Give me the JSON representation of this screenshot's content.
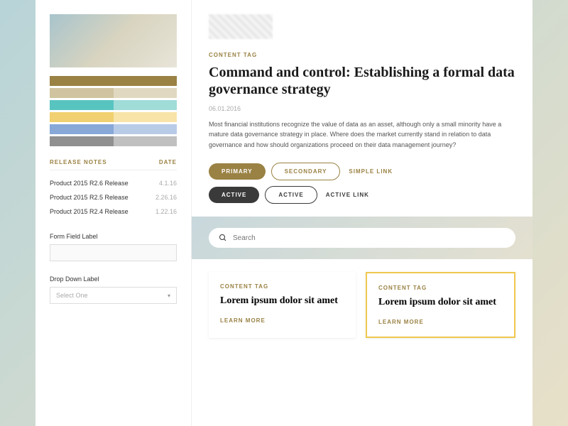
{
  "sidebar": {
    "swatches": [
      [
        "#9a8244",
        "#9a8244"
      ],
      [
        "#d0c4a0",
        "#e0d8c0"
      ],
      [
        "#58c4c0",
        "#a0dcd8"
      ],
      [
        "#f0d070",
        "#f8e4a8"
      ],
      [
        "#88a8d8",
        "#b8cce8"
      ],
      [
        "#909090",
        "#c0c0c0"
      ]
    ],
    "release": {
      "header_left": "RELEASE NOTES",
      "header_right": "DATE",
      "rows": [
        {
          "name": "Product 2015 R2.6 Release",
          "date": "4.1.16"
        },
        {
          "name": "Product 2015 R2.5 Release",
          "date": "2.26.16"
        },
        {
          "name": "Product 2015 R2.4 Release",
          "date": "1.22.16"
        }
      ]
    },
    "form": {
      "field_label": "Form Field Label",
      "dropdown_label": "Drop Down Label",
      "dropdown_placeholder": "Select One"
    }
  },
  "main": {
    "tag": "CONTENT TAG",
    "headline": "Command and control: Establishing a formal data governance strategy",
    "date": "06.01.2016",
    "body": "Most financial institutions recognize the value of data as an asset, although only a small minority have a mature data governance strategy in place. Where does the market currently stand in relation to data governance and how should organizations proceed on their data management journey?",
    "buttons": {
      "primary": "PRIMARY",
      "secondary": "SECONDARY",
      "link": "SIMPLE LINK",
      "active": "ACTIVE",
      "active_outline": "ACTIVE",
      "active_link": "ACTIVE LINK"
    },
    "search_placeholder": "Search",
    "cards": [
      {
        "tag": "CONTENT TAG",
        "title": "Lorem ipsum dolor sit amet",
        "cta": "LEARN MORE",
        "highlighted": false
      },
      {
        "tag": "CONTENT TAG",
        "title": "Lorem ipsum dolor sit amet",
        "cta": "LEARN MORE",
        "highlighted": true
      }
    ]
  }
}
